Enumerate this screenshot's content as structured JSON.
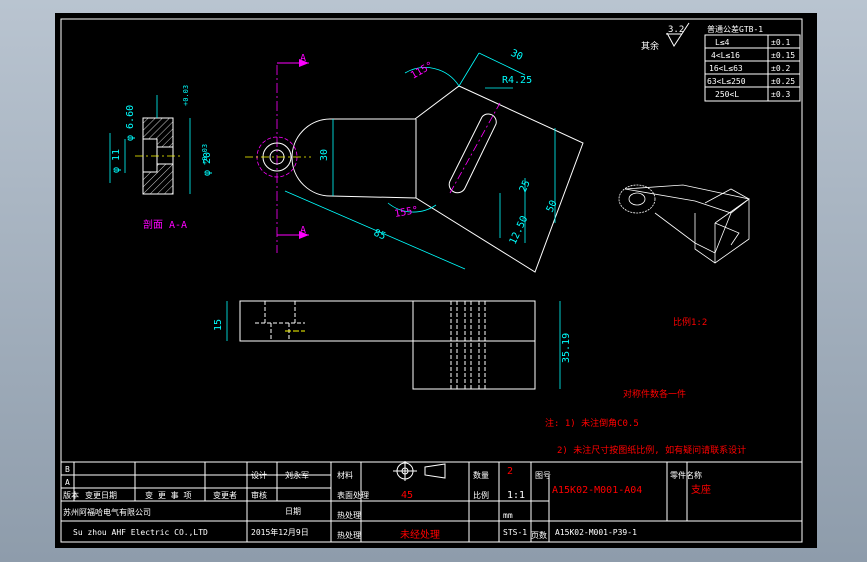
{
  "colors": {
    "background": "#000000",
    "outline": "#ffffff",
    "dimension": "#00ffff",
    "centerline": "#ffff00",
    "section_mark": "#ff00ff",
    "note": "#ff0000",
    "viewport_bg": "#a3b0be"
  },
  "surface": {
    "value": "3.2",
    "label": "其余"
  },
  "tolerance_table": {
    "title": "普通公差GTB-1",
    "rows": [
      {
        "range": "L≤4",
        "value": "±0.1"
      },
      {
        "range": "4<L≤16",
        "value": "±0.15"
      },
      {
        "range": "16<L≤63",
        "value": "±0.2"
      },
      {
        "range": "63<L≤250",
        "value": "±0.25"
      },
      {
        "range": "250<L",
        "value": "±0.3"
      }
    ]
  },
  "section_view": {
    "label": "剖面 A-A",
    "dims": {
      "d1": "φ 6.60",
      "d2": "φ 11",
      "d3": "φ 20",
      "tol1": "+0.03",
      "tol2": "+0.03"
    }
  },
  "main_view": {
    "dims": {
      "angle1": "115°",
      "angle2": "155°",
      "width": "30",
      "radius": "R4.25",
      "height": "30",
      "d25": "25",
      "d50": "50",
      "d1250": "12.50",
      "d85": "85"
    },
    "section_marker": "A"
  },
  "side_view": {
    "dims": {
      "d15": "15",
      "d3519": "35.19"
    }
  },
  "notes": {
    "scale": "比例1:2",
    "quantity": "对称件数各一件",
    "note1": "注: 1) 未注倒角C0.5",
    "note2": "2) 未注尺寸按图纸比例, 如有疑问请联系设计"
  },
  "title_block": {
    "rev_b": "B",
    "rev_a": "A",
    "hdr_version": "版本",
    "hdr_date": "变更日期",
    "hdr_item": "变 更 事 项",
    "hdr_changer": "变更者",
    "lbl_design": "设计",
    "designer": "刘永军",
    "lbl_check": "审核",
    "lbl_date": "日期",
    "lbl_material": "材料",
    "lbl_count": "数量",
    "count": "2",
    "lbl_treatment": "表面处理",
    "material": "45",
    "lbl_scale": "比例",
    "scale": "1:1",
    "unit": "mm",
    "company_cn": "苏州阿福哈电气有限公司",
    "company_en": "Su zhou AHF Electric CO.,LTD",
    "date": "2015年12月9日",
    "lbl_heat": "热处理",
    "heat": "未经处理",
    "lbl_drawing_no": "图号",
    "drawing_no": "A15K02-M001-A04",
    "lbl_part_name": "零件名称",
    "part_name": "支座",
    "project_no": "A15K02-M001-P39-1",
    "sts": "STS-1",
    "lbl_page": "页数"
  }
}
